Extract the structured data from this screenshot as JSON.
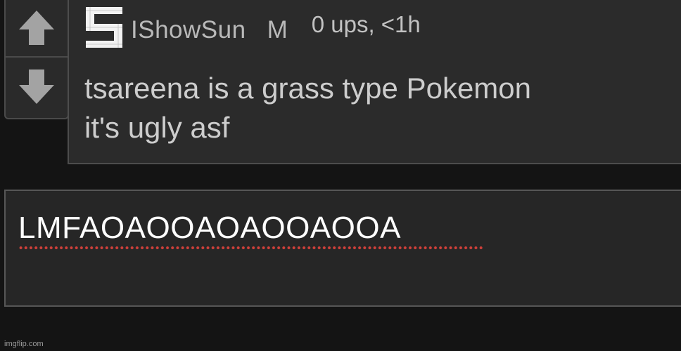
{
  "comment": {
    "username": "IShowSun",
    "gender": "M",
    "meta": "0 ups, <1h",
    "lines": [
      "tsareena is a grass type Pokemon",
      "it's ugly asf"
    ]
  },
  "vote": {
    "up_icon": "arrow-up-icon",
    "down_icon": "arrow-down-icon"
  },
  "reply": {
    "value": "LMFAOAOOAOAOOAOOA"
  },
  "footer": {
    "watermark": "imgflip.com"
  },
  "colors": {
    "background": "#141414",
    "panel": "#2b2b2b",
    "border": "#4d4d4d",
    "text": "#cdcdcd",
    "spellcheck": "#d0403a"
  }
}
